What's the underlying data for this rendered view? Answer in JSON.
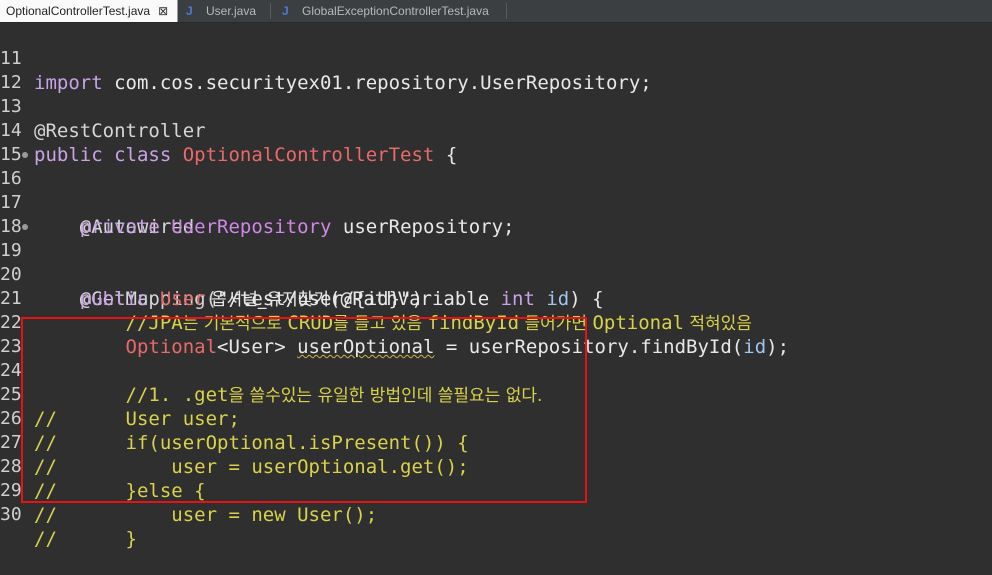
{
  "tabs": [
    {
      "label": "OptionalControllerTest.java",
      "active": true,
      "close": "⊠"
    },
    {
      "label": "User.java",
      "active": false
    },
    {
      "label": "GlobalExceptionControllerTest.java",
      "active": false
    }
  ],
  "lines": [
    {
      "n": "11"
    },
    {
      "n": "12"
    },
    {
      "n": "13"
    },
    {
      "n": "14"
    },
    {
      "n": "15"
    },
    {
      "n": "16"
    },
    {
      "n": "17"
    },
    {
      "n": "18"
    },
    {
      "n": "19"
    },
    {
      "n": "20"
    },
    {
      "n": "21"
    },
    {
      "n": "22"
    },
    {
      "n": "23"
    },
    {
      "n": "24"
    },
    {
      "n": "25"
    },
    {
      "n": "26"
    },
    {
      "n": "27"
    },
    {
      "n": "28"
    },
    {
      "n": "29"
    },
    {
      "n": "30"
    }
  ],
  "code": {
    "l11a": "import",
    "l11b": " com.cos.securityex01.repository.UserRepository;",
    "l13": "@RestController",
    "l14a": "public class ",
    "l14b": "OptionalControllerTest",
    "l14c": " {",
    "l16": "    @Autowired",
    "l17a": "    private ",
    "l17b": "UserRepository",
    "l17c": " userRepository;",
    "l19a": "    @GetMapping(",
    "l19b": "\"/test/user/{id}\"",
    "l19c": ")",
    "l20a": "    public ",
    "l20b": "User",
    "l20c": " 옵셔널_유저찾기",
    "l20d": "(@PathVariable ",
    "l20e": "int",
    "l20f": " id",
    "l20g": ") {",
    "l21a": "        //JPA",
    "l21b": "는 기본적으로 ",
    "l21c": "CRUD",
    "l21d": "를 들고 있음 ",
    "l21e": "findById",
    "l21f": " 들어가면 ",
    "l21g": "Optional",
    "l21h": " 적혀있음",
    "l22a": "        ",
    "l22b": "Optional",
    "l22c": "<User> ",
    "l22d": "userOptional",
    "l22e": " = userRepository.findById(",
    "l22f": "id",
    "l22g": ");",
    "l24a": "        //1. .get",
    "l24b": "을 쓸수있는 유일한 방법인데 쓸필요는 없다.",
    "l25": "//      User user;",
    "l26": "//      if(userOptional.isPresent()) {",
    "l27": "//          user = userOptional.get();",
    "l28": "//      }else {",
    "l29": "//          user = new User();",
    "l30": "//      }"
  }
}
